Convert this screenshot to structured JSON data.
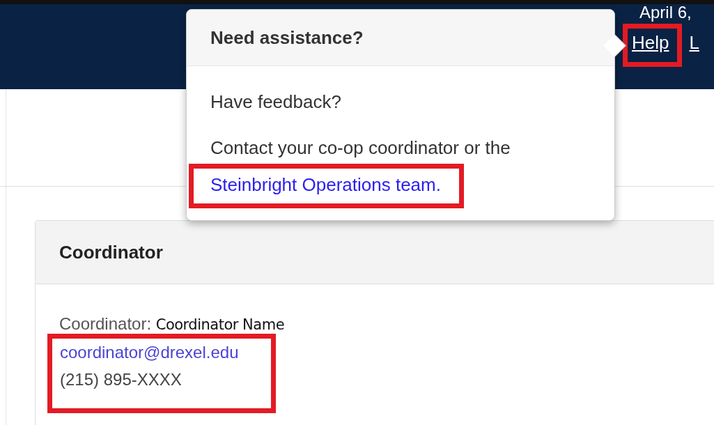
{
  "header": {
    "date": "April 6,",
    "links": [
      {
        "label": "Help",
        "highlighted": true
      },
      {
        "label": "L",
        "highlighted": false
      }
    ]
  },
  "popover": {
    "title": "Need assistance?",
    "question": "Have feedback?",
    "contact_text": "Contact your co-op coordinator or the ",
    "contact_link": "Steinbright Operations team.",
    "link_highlighted": true
  },
  "card": {
    "title": "Coordinator",
    "label": "Coordinator:",
    "name": "Coordinator Name",
    "email": "coordinator@drexel.edu",
    "phone": "(215) 895-XXXX",
    "contact_highlighted": true
  }
}
